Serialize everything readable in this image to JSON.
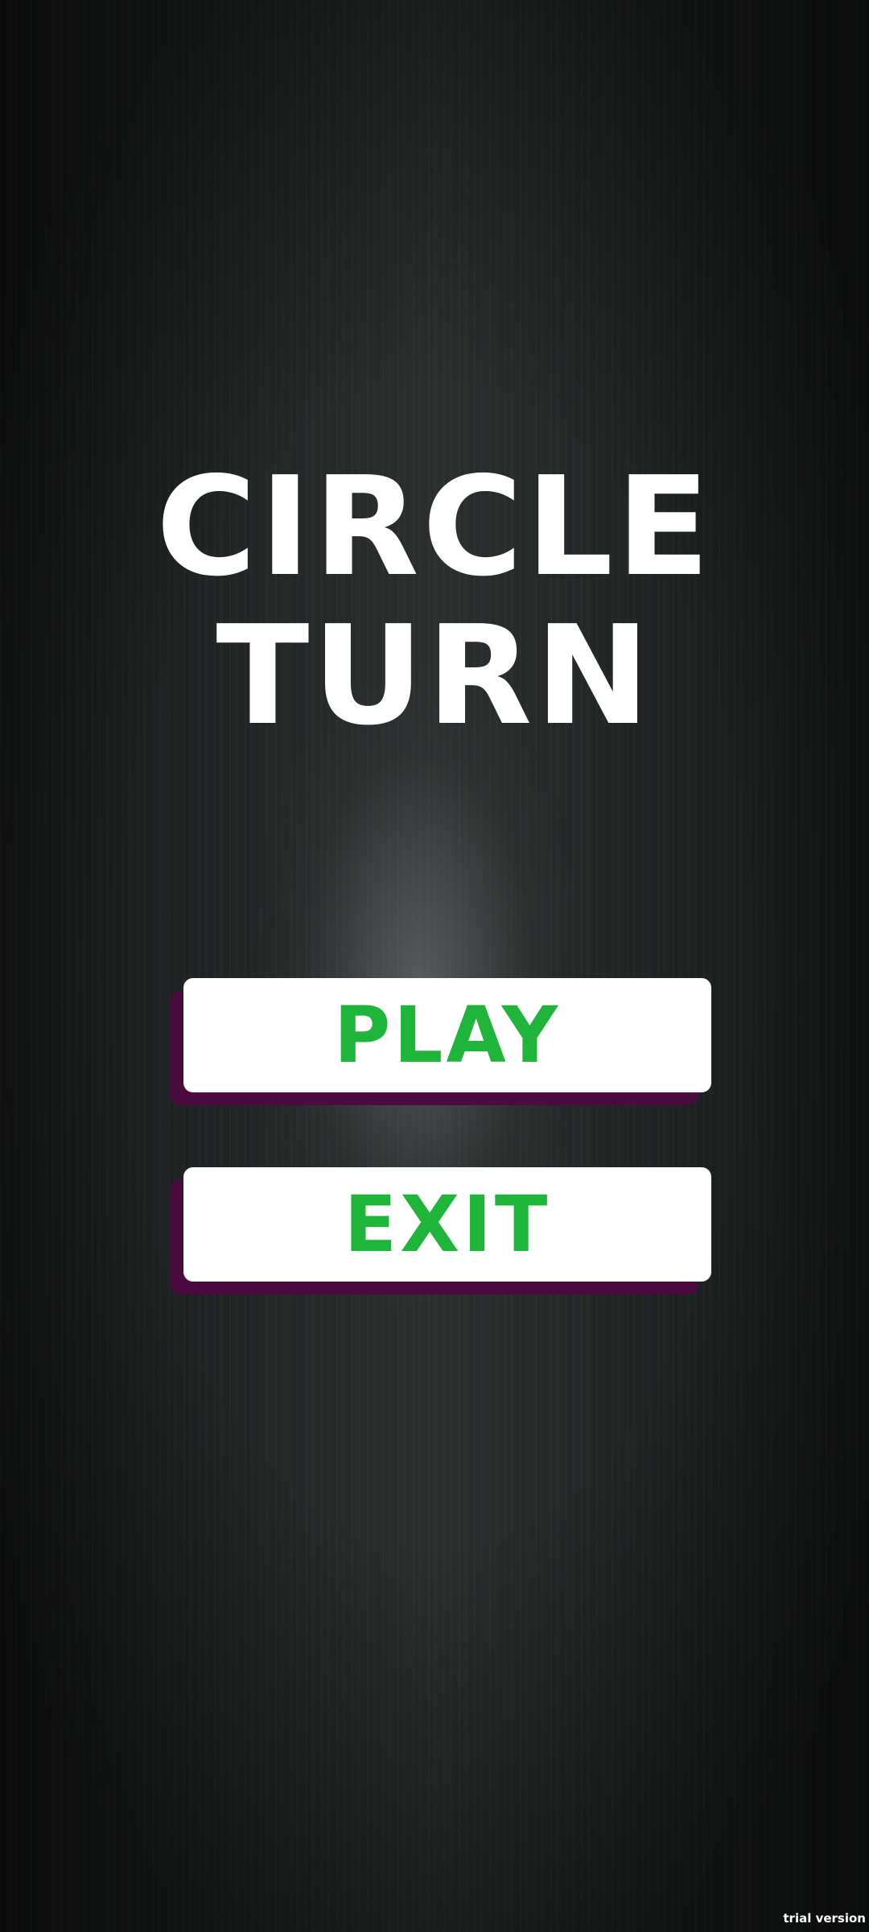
{
  "game": {
    "title_line_1": "CIRCLE",
    "title_line_2": "TURN"
  },
  "menu": {
    "play_label": "PLAY",
    "exit_label": "EXIT"
  },
  "watermark": "trial version",
  "colors": {
    "background": "#262929",
    "title_text": "#ffffff",
    "button_face": "#ffffff",
    "button_shadow": "#4a0b3e",
    "button_text": "#1fb43a"
  }
}
